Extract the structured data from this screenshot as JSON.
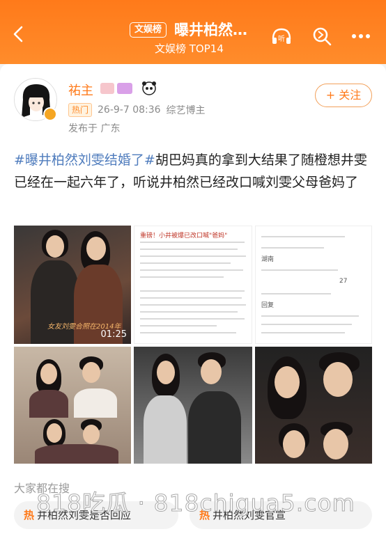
{
  "header": {
    "tag": "文娱榜",
    "title": "曝井柏然…",
    "subtitle": "文娱榜 TOP14",
    "listen_label": "听"
  },
  "post": {
    "username": "祐主",
    "follow_label": "+ 关注",
    "hot_badge": "热门",
    "time": "26-9-7 08:36",
    "category": "综艺博主",
    "location": "发布于 广东",
    "hashtag": "#曝井柏然刘雯结婚了#",
    "text": "胡巴妈真的拿到大结果了随橙想井雯已经在一起六年了，听说井柏然已经改口喊刘雯父母爸妈了",
    "video_duration": "01:25",
    "video_caption": "女友刘雯合照在2014年"
  },
  "article": {
    "headline": "重磅！小井被爆已改口喊\"爸妈\"",
    "comment_reply": "回复",
    "location_tag": "湖南",
    "comment_count": "27"
  },
  "search": {
    "section_title": "大家都在搜",
    "items": [
      "井柏然刘雯是否回应",
      "井柏然刘雯官宣"
    ]
  },
  "watermark": "818吃瓜 · 818chigua5.com",
  "colors": {
    "brand_orange": "#ff7a1a",
    "hashtag_blue": "#4f7cbd"
  },
  "icons": [
    "back-arrow-icon",
    "listen-icon",
    "search-icon",
    "more-icon",
    "verified-icon",
    "hot-search-icon"
  ]
}
